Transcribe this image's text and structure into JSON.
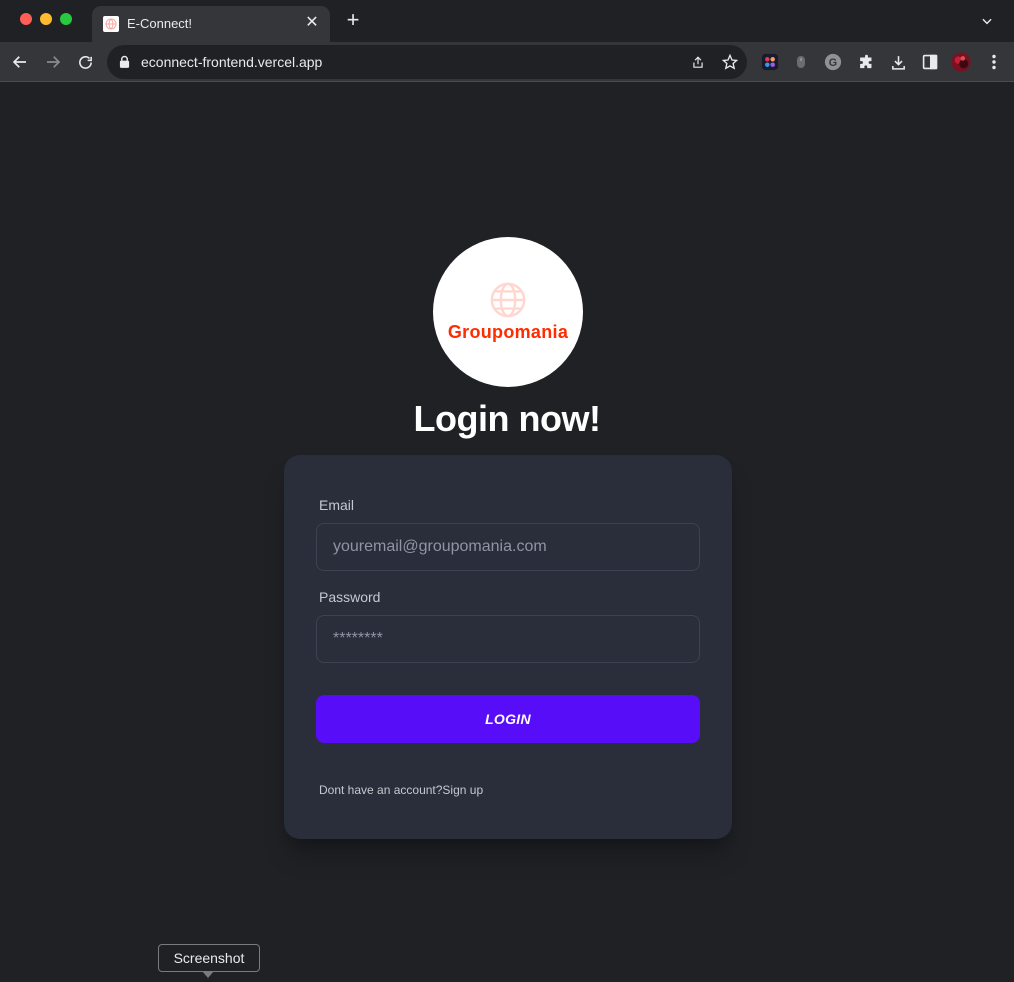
{
  "browser": {
    "tab_title": "E-Connect!",
    "url": "econnect-frontend.vercel.app",
    "new_tab_symbol": "+",
    "close_symbol": "✕"
  },
  "page": {
    "logo_text": "Groupomania",
    "heading": "Login now!",
    "email_label": "Email",
    "email_placeholder": "youremail@groupomania.com",
    "password_label": "Password",
    "password_placeholder": "********",
    "login_button": "LOGIN",
    "signup_prompt": "Dont have an account?",
    "signup_link": "Sign up"
  },
  "tooltip": {
    "text": "Screenshot"
  },
  "colors": {
    "background": "#202125",
    "card": "#2a2d3a",
    "button": "#570df8",
    "logo_red": "#fd2d01"
  }
}
